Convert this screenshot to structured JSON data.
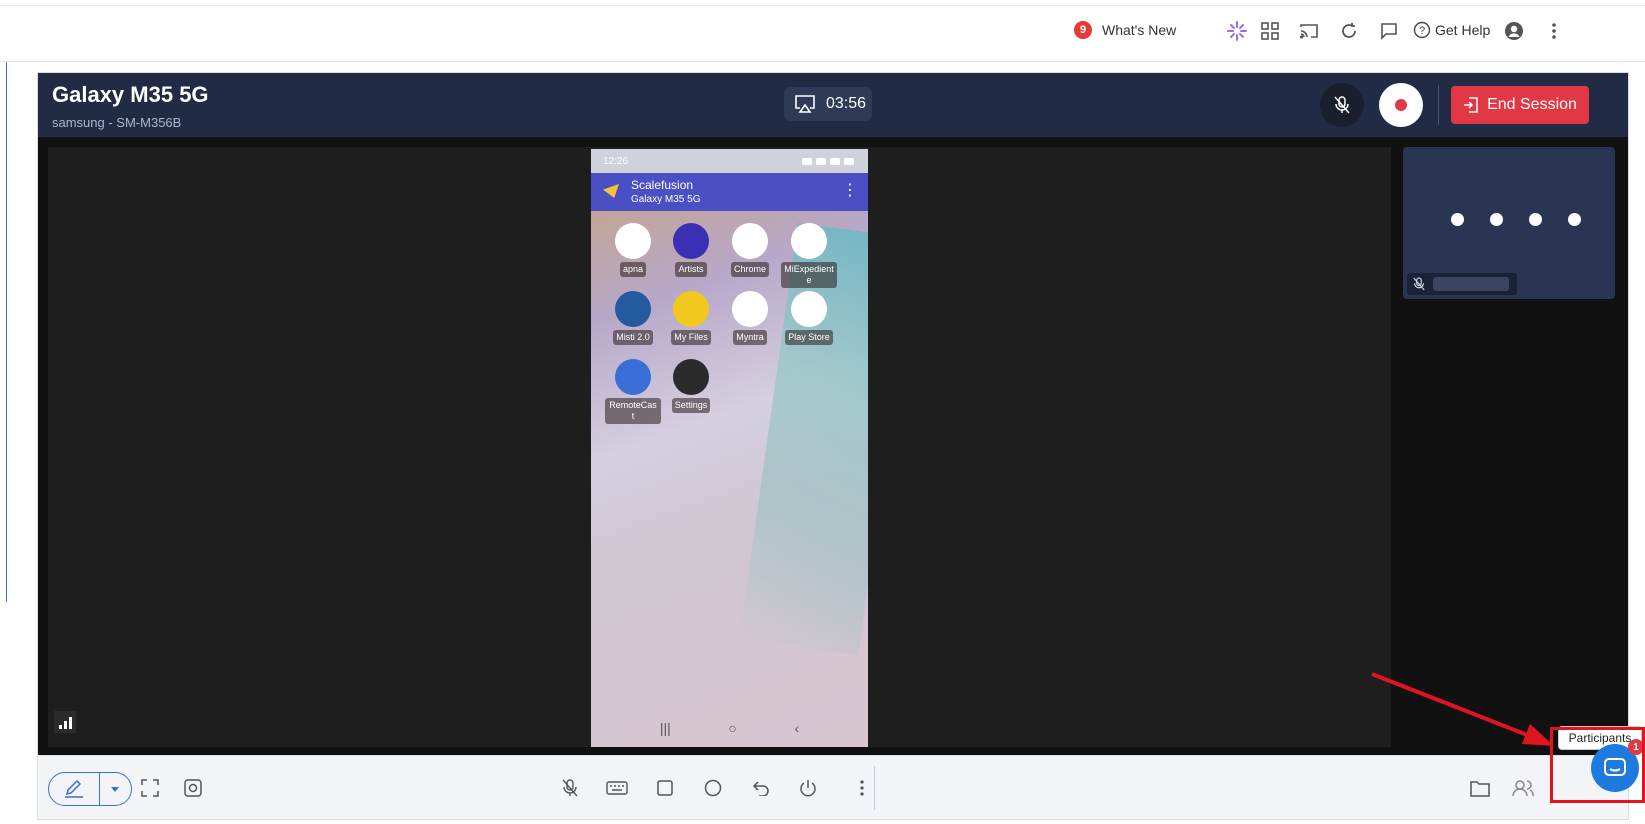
{
  "topbar": {
    "whats_new_count": "9",
    "whats_new_label": "What's New",
    "get_help_label": "Get Help"
  },
  "session": {
    "device_name": "Galaxy M35 5G",
    "device_model": "samsung - SM-M356B",
    "timer": "03:56",
    "end_session_label": "End Session"
  },
  "phone": {
    "status_time": "12:26",
    "app_title": "Scalefusion",
    "app_subtitle": "Galaxy M35 5G",
    "apps": [
      {
        "label": "apna",
        "icon": "apna",
        "color": "#ffffff",
        "text_color": "#222"
      },
      {
        "label": "Artists",
        "icon": "spotify-icon",
        "color": "#3b2fb3",
        "text_color": "#fff"
      },
      {
        "label": "Chrome",
        "icon": "chrome-icon",
        "color": "#ffffff",
        "text_color": "#222"
      },
      {
        "label": "MiExpediente",
        "icon": "caja",
        "color": "#ffffff",
        "text_color": "#1a2b6b"
      },
      {
        "label": "Misti 2.0",
        "icon": "misti-icon",
        "color": "#245b9e",
        "text_color": "#fff"
      },
      {
        "label": "My Files",
        "icon": "folder-icon",
        "color": "#f2c81e",
        "text_color": "#fff"
      },
      {
        "label": "Myntra",
        "icon": "myntra-icon",
        "color": "#ffffff",
        "text_color": "#e83e8c"
      },
      {
        "label": "Play Store",
        "icon": "play-store-icon",
        "color": "#ffffff",
        "text_color": "#222"
      },
      {
        "label": "RemoteCast",
        "icon": "remotecast-icon",
        "color": "#3a6fd8",
        "text_color": "#fff"
      },
      {
        "label": "Settings",
        "icon": "settings-icon",
        "color": "#2b2b2b",
        "text_color": "#fff"
      }
    ]
  },
  "participants": {
    "tooltip": "Participants",
    "chat_unread": "1"
  },
  "colors": {
    "header_bg": "#222b45",
    "end_session": "#e23744",
    "accent": "#3a6fd8"
  }
}
